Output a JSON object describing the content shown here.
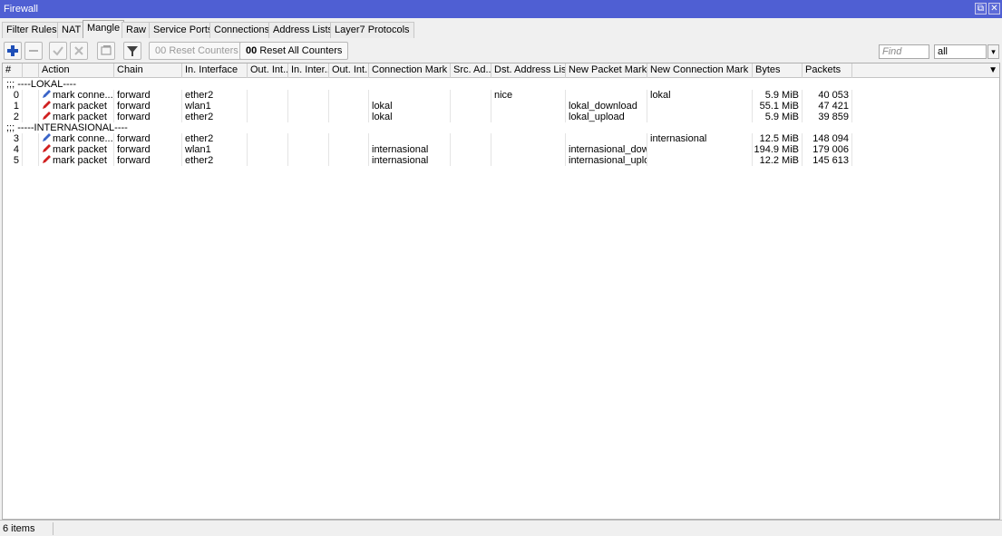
{
  "window": {
    "title": "Firewall",
    "restore_symbol": "⧉",
    "close_symbol": "✕"
  },
  "tabs": [
    "Filter Rules",
    "NAT",
    "Mangle",
    "Raw",
    "Service Ports",
    "Connections",
    "Address Lists",
    "Layer7 Protocols"
  ],
  "active_tab": "Mangle",
  "toolbar": {
    "add_icon": "plus-icon",
    "remove_icon": "minus-icon",
    "enable_icon": "check-icon",
    "disable_icon": "x-icon",
    "comment_icon": "comment-icon",
    "filter_icon": "filter-icon",
    "reset_counters_label": "Reset Counters",
    "reset_all_counters_label": "Reset All Counters",
    "counter_prefix": "00",
    "find_placeholder": "Find",
    "filter_select_value": "all",
    "dropdown_symbol": "▾"
  },
  "table": {
    "columns": [
      "#",
      "",
      "Action",
      "Chain",
      "In. Interface",
      "Out. Int...",
      "In. Inter...",
      "Out. Int...",
      "Connection Mark",
      "Src. Ad...",
      "Dst. Address List",
      "New Packet Mark",
      "New Connection Mark",
      "Bytes",
      "Packets"
    ],
    "header_menu_symbol": "▼",
    "rows": [
      {
        "type": "comment",
        "text": ";;; ----LOKAL----"
      },
      {
        "type": "rule",
        "num": "0",
        "action": "mark conne...",
        "icon": "pencil-blue-icon",
        "chain": "forward",
        "in_interface": "ether2",
        "out_interface": "",
        "in_interface_list": "",
        "out_interface_list": "",
        "connection_mark": "",
        "src_address": "",
        "dst_address_list": "nice",
        "new_packet_mark": "",
        "new_connection_mark": "lokal",
        "bytes": "5.9 MiB",
        "packets": "40 053"
      },
      {
        "type": "rule",
        "num": "1",
        "action": "mark packet",
        "icon": "pencil-red-icon",
        "chain": "forward",
        "in_interface": "wlan1",
        "out_interface": "",
        "in_interface_list": "",
        "out_interface_list": "",
        "connection_mark": "lokal",
        "src_address": "",
        "dst_address_list": "",
        "new_packet_mark": "lokal_download",
        "new_connection_mark": "",
        "bytes": "55.1 MiB",
        "packets": "47 421"
      },
      {
        "type": "rule",
        "num": "2",
        "action": "mark packet",
        "icon": "pencil-red-icon",
        "chain": "forward",
        "in_interface": "ether2",
        "out_interface": "",
        "in_interface_list": "",
        "out_interface_list": "",
        "connection_mark": "lokal",
        "src_address": "",
        "dst_address_list": "",
        "new_packet_mark": "lokal_upload",
        "new_connection_mark": "",
        "bytes": "5.9 MiB",
        "packets": "39 859"
      },
      {
        "type": "comment",
        "text": ";;; -----INTERNASIONAL----"
      },
      {
        "type": "rule",
        "num": "3",
        "action": "mark conne...",
        "icon": "pencil-blue-icon",
        "chain": "forward",
        "in_interface": "ether2",
        "out_interface": "",
        "in_interface_list": "",
        "out_interface_list": "",
        "connection_mark": "",
        "src_address": "",
        "dst_address_list": "",
        "new_packet_mark": "",
        "new_connection_mark": "internasional",
        "bytes": "12.5 MiB",
        "packets": "148 094"
      },
      {
        "type": "rule",
        "num": "4",
        "action": "mark packet",
        "icon": "pencil-red-icon",
        "chain": "forward",
        "in_interface": "wlan1",
        "out_interface": "",
        "in_interface_list": "",
        "out_interface_list": "",
        "connection_mark": "internasional",
        "src_address": "",
        "dst_address_list": "",
        "new_packet_mark": "internasional_dow...",
        "new_connection_mark": "",
        "bytes": "194.9 MiB",
        "packets": "179 006"
      },
      {
        "type": "rule",
        "num": "5",
        "action": "mark packet",
        "icon": "pencil-red-icon",
        "chain": "forward",
        "in_interface": "ether2",
        "out_interface": "",
        "in_interface_list": "",
        "out_interface_list": "",
        "connection_mark": "internasional",
        "src_address": "",
        "dst_address_list": "",
        "new_packet_mark": "internasional_uplo...",
        "new_connection_mark": "",
        "bytes": "12.2 MiB",
        "packets": "145 613"
      }
    ]
  },
  "status": {
    "items_text": "6 items"
  },
  "colors": {
    "titlebar": "#4f5fd3",
    "pencil_blue": "#3a64c8",
    "pencil_red": "#d02020"
  }
}
